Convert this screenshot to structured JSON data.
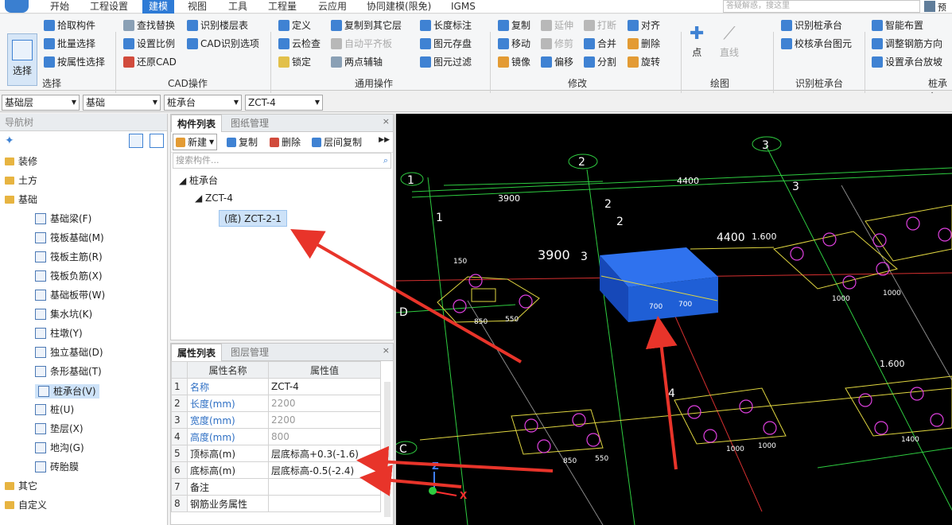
{
  "menu": {
    "items": [
      "开始",
      "工程设置",
      "建模",
      "视图",
      "工具",
      "工程量",
      "云应用",
      "协同建模(限免)",
      "IGMS"
    ],
    "active_index": 2,
    "search_placeholder": "答疑解惑，搜这里",
    "preview_label": "预览"
  },
  "ribbon": {
    "select_big": "选择",
    "select_group": [
      "拾取构件",
      "批量选择",
      "按属性选择"
    ],
    "cad_ops": [
      "查找替换",
      "设置比例",
      "还原CAD",
      "识别楼层表",
      "CAD识别选项"
    ],
    "general_ops": [
      "定义",
      "云检查",
      "锁定",
      "复制到其它层",
      "自动平齐板",
      "两点辅轴",
      "长度标注",
      "图元存盘",
      "图元过滤"
    ],
    "modify_ops": [
      "复制",
      "移动",
      "镜像",
      "延伸",
      "修剪",
      "偏移",
      "打断",
      "合并",
      "分割",
      "对齐",
      "删除",
      "旋转"
    ],
    "draw_ops": [
      "点",
      "直线"
    ],
    "recognize_ops": [
      "识别桩承台",
      "校核承台图元"
    ],
    "extra_ops": [
      "智能布置",
      "调整钢筋方向",
      "设置承台放坡"
    ],
    "group_labels": [
      "选择",
      "CAD操作",
      "通用操作",
      "修改",
      "绘图",
      "识别桩承台",
      "桩承台"
    ]
  },
  "selectors": [
    "基础层",
    "基础",
    "桩承台",
    "ZCT-4"
  ],
  "nav": {
    "title": "导航树",
    "items": [
      {
        "label": "装修",
        "type": "folder"
      },
      {
        "label": "土方",
        "type": "folder"
      },
      {
        "label": "基础",
        "type": "folder"
      },
      {
        "label": "基础梁(F)",
        "type": "item"
      },
      {
        "label": "筏板基础(M)",
        "type": "item"
      },
      {
        "label": "筏板主筋(R)",
        "type": "item"
      },
      {
        "label": "筏板负筋(X)",
        "type": "item"
      },
      {
        "label": "基础板带(W)",
        "type": "item"
      },
      {
        "label": "集水坑(K)",
        "type": "item"
      },
      {
        "label": "柱墩(Y)",
        "type": "item"
      },
      {
        "label": "独立基础(D)",
        "type": "item"
      },
      {
        "label": "条形基础(T)",
        "type": "item"
      },
      {
        "label": "桩承台(V)",
        "type": "item",
        "active": true
      },
      {
        "label": "桩(U)",
        "type": "item"
      },
      {
        "label": "垫层(X)",
        "type": "item"
      },
      {
        "label": "地沟(G)",
        "type": "item"
      },
      {
        "label": "砖胎膜",
        "type": "item"
      },
      {
        "label": "其它",
        "type": "folder"
      },
      {
        "label": "自定义",
        "type": "folder"
      }
    ]
  },
  "component_list": {
    "tabs": [
      "构件列表",
      "图纸管理"
    ],
    "toolbar": [
      "新建",
      "复制",
      "删除",
      "层间复制"
    ],
    "search_placeholder": "搜索构件...",
    "tree": {
      "root": "桩承台",
      "child": "ZCT-4",
      "leaf": "(底) ZCT-2-1"
    }
  },
  "properties": {
    "tabs": [
      "属性列表",
      "图层管理"
    ],
    "headers": [
      "属性名称",
      "属性值"
    ],
    "rows": [
      {
        "n": "1",
        "name": "名称",
        "value": "ZCT-4",
        "name_blue": true,
        "value_grey": false
      },
      {
        "n": "2",
        "name": "长度(mm)",
        "value": "2200",
        "name_blue": true,
        "value_grey": true
      },
      {
        "n": "3",
        "name": "宽度(mm)",
        "value": "2200",
        "name_blue": true,
        "value_grey": true
      },
      {
        "n": "4",
        "name": "高度(mm)",
        "value": "800",
        "name_blue": true,
        "value_grey": true
      },
      {
        "n": "5",
        "name": "顶标高(m)",
        "value": "层底标高+0.3(-1.6)",
        "name_blue": false,
        "value_grey": false
      },
      {
        "n": "6",
        "name": "底标高(m)",
        "value": "层底标高-0.5(-2.4)",
        "name_blue": false,
        "value_grey": false
      },
      {
        "n": "7",
        "name": "备注",
        "value": "",
        "name_blue": false,
        "value_grey": false
      },
      {
        "n": "8",
        "name": "钢筋业务属性",
        "value": "",
        "name_blue": false,
        "value_grey": false
      }
    ]
  },
  "canvas": {
    "labels": [
      "1",
      "1",
      "2",
      "2",
      "2",
      "3",
      "3",
      "3",
      "4",
      "D",
      "C"
    ],
    "dims": [
      "3900",
      "4400",
      "3900",
      "4400",
      "1.600",
      "150",
      "850",
      "550",
      "700",
      "700",
      "1000",
      "1000",
      "850",
      "550",
      "1000",
      "1000",
      "1400",
      "1.600"
    ],
    "axis": [
      "X",
      "Z"
    ]
  },
  "colors": {
    "accent": "#2e7bd6",
    "canvas_bg": "#000000",
    "box_blue": "#1f5fd6",
    "cad_green": "#2ecc40",
    "cad_yellow": "#e0d640",
    "cad_magenta": "#e040e0",
    "arrow_red": "#e8342a"
  }
}
